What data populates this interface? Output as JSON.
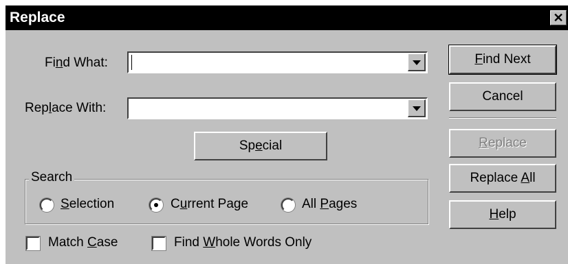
{
  "window": {
    "title": "Replace",
    "close_glyph": "✕"
  },
  "find": {
    "label_pre": "Fi",
    "label_key": "n",
    "label_post": "d What:",
    "value": ""
  },
  "replace": {
    "label_pre": "Rep",
    "label_key": "l",
    "label_post": "ace With:",
    "value": ""
  },
  "special": {
    "pre": "Sp",
    "key": "e",
    "post": "cial"
  },
  "buttons": {
    "find_next": {
      "pre": "",
      "key": "F",
      "post": "ind Next"
    },
    "cancel": "Cancel",
    "replace": {
      "pre": "",
      "key": "R",
      "post": "eplace",
      "enabled": false
    },
    "replace_all": {
      "pre": "Replace ",
      "key": "A",
      "post": "ll"
    },
    "help": {
      "pre": "",
      "key": "H",
      "post": "elp"
    }
  },
  "search": {
    "label": "Search",
    "options": [
      {
        "pre": "",
        "key": "S",
        "post": "election",
        "selected": false
      },
      {
        "pre": "C",
        "key": "u",
        "post": "rrent Page",
        "selected": true
      },
      {
        "pre": "All ",
        "key": "P",
        "post": "ages",
        "selected": false
      }
    ]
  },
  "options": {
    "match_case": {
      "pre": "Match ",
      "key": "C",
      "post": "ase",
      "checked": false
    },
    "whole_words": {
      "pre": "Find ",
      "key": "W",
      "post": "hole Words Only",
      "checked": false
    }
  }
}
